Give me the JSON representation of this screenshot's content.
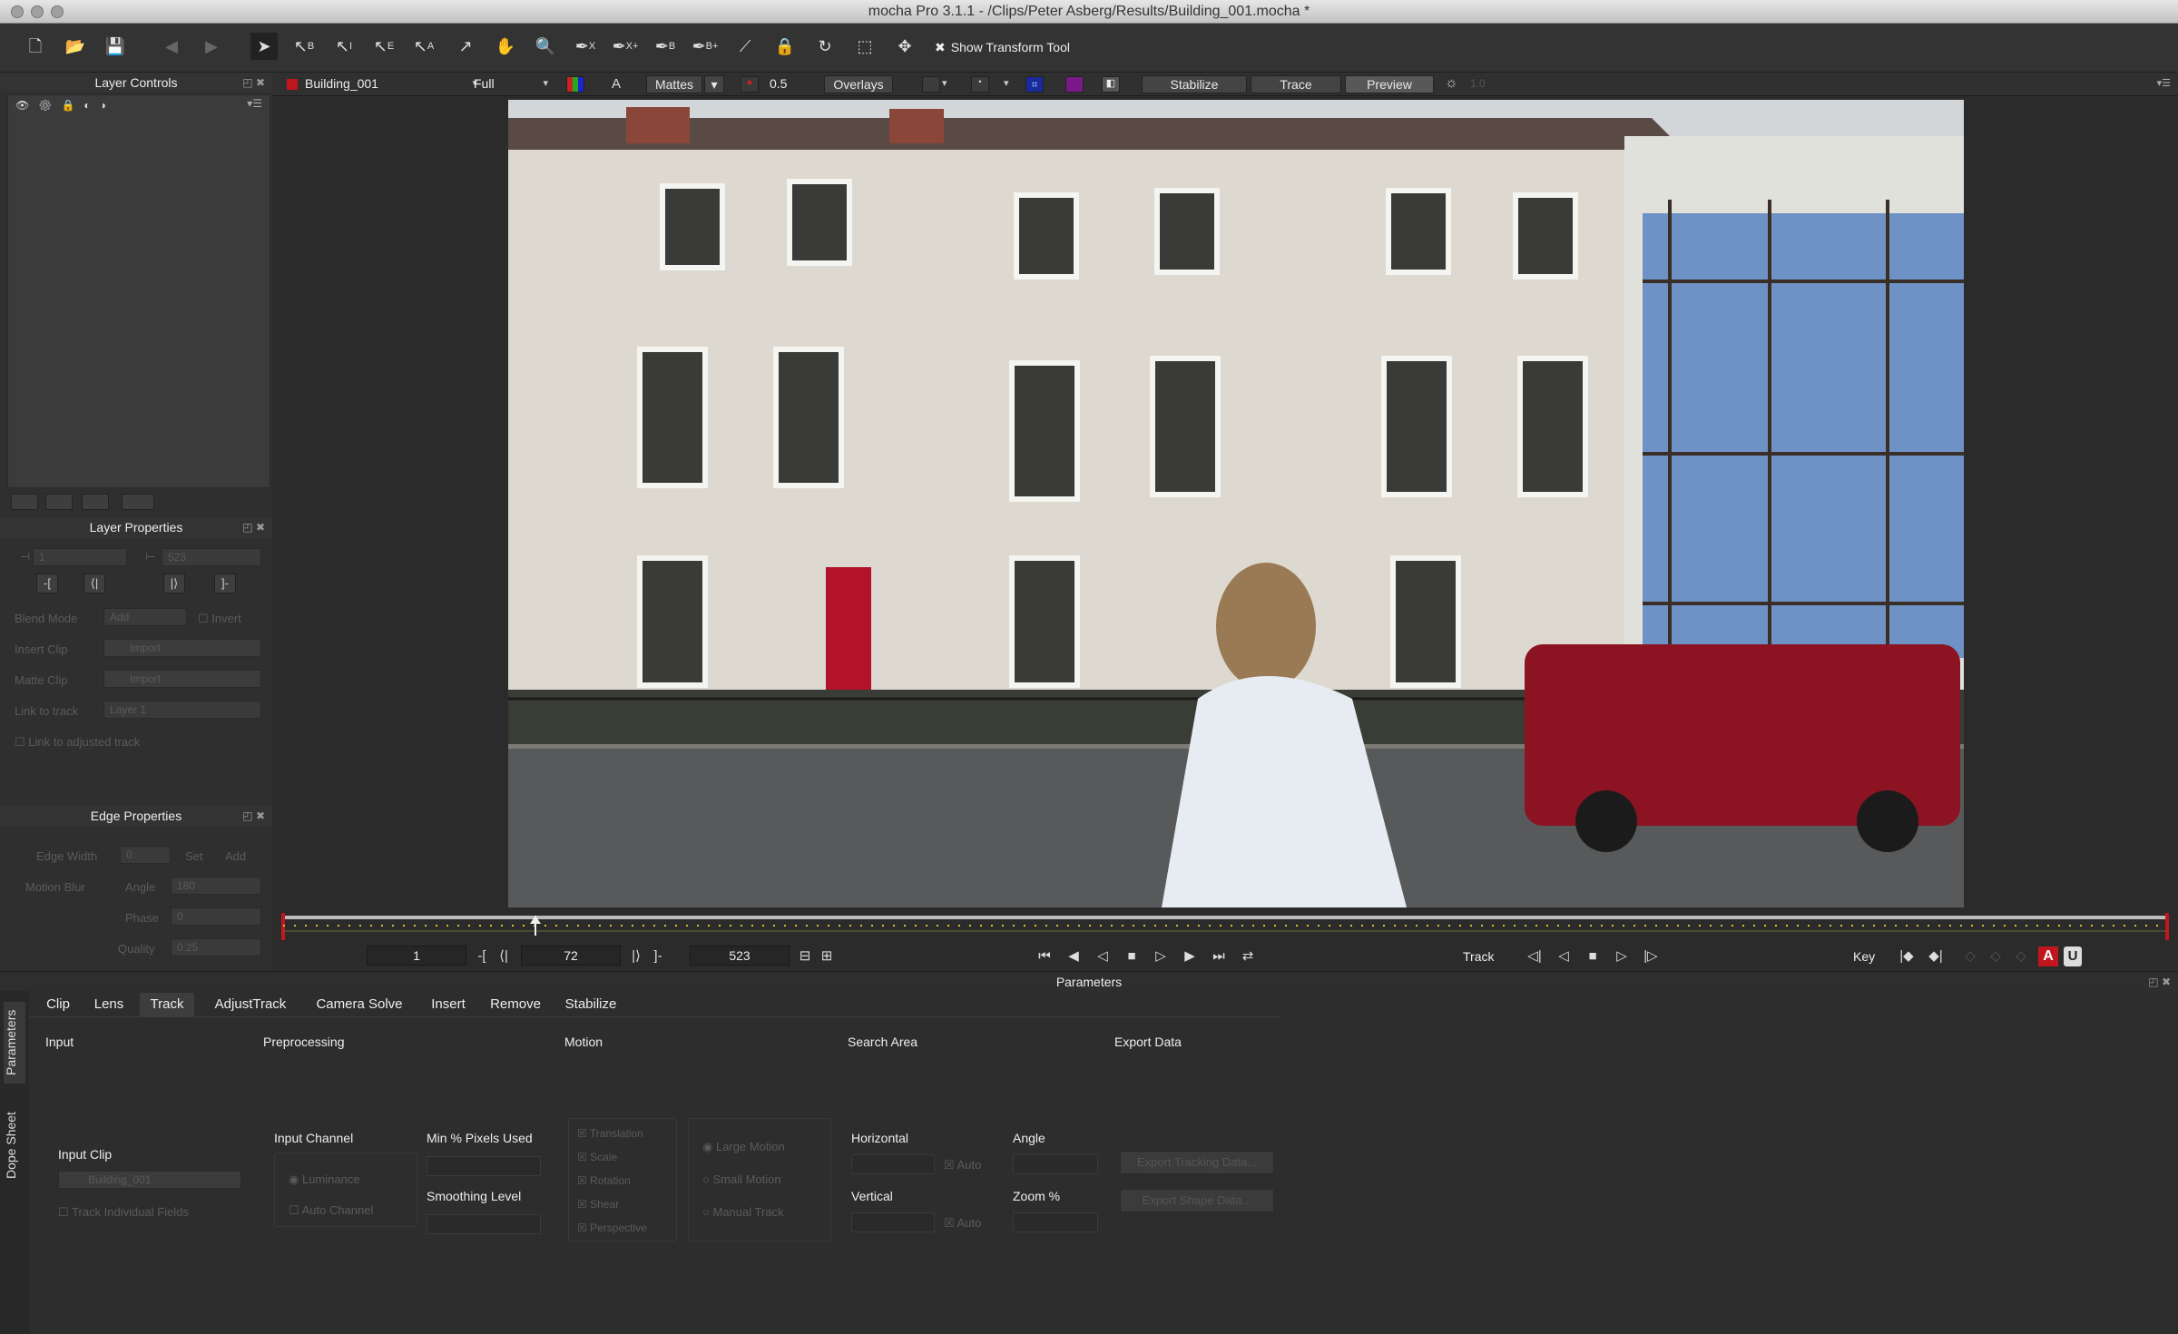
{
  "window": {
    "title": "mocha Pro 3.1.1 - /Clips/Peter Asberg/Results/Building_001.mocha *"
  },
  "toolbar": {
    "show_transform_label": "Show Transform Tool",
    "icons": [
      "new-file-icon",
      "open-folder-icon",
      "save-icon",
      "back-arrow-icon",
      "forward-arrow-icon",
      "pointer-icon",
      "pointer-b-icon",
      "pointer-i-icon",
      "pointer-e-icon",
      "pointer-a-icon",
      "add-point-icon",
      "hand-icon",
      "zoom-icon",
      "pen-x-icon",
      "pen-x-plus-icon",
      "pen-b-icon",
      "pen-b-plus-icon",
      "join-icon",
      "lock-icon",
      "rotate-icon",
      "scale-icon",
      "move-icon"
    ]
  },
  "viewer_bar": {
    "clip": "Building_001",
    "view": "Full",
    "mattes": "Mattes",
    "opacity": "0.5",
    "overlays": "Overlays",
    "stabilize": "Stabilize",
    "trace": "Trace",
    "preview": "Preview",
    "exposure": "1.0"
  },
  "left": {
    "layer_controls": "Layer Controls",
    "layer_properties": "Layer Properties",
    "in_value": "1",
    "out_value": "523",
    "blend_mode_label": "Blend Mode",
    "blend_mode_value": "Add",
    "invert_label": "Invert",
    "insert_clip_label": "Insert Clip",
    "insert_clip_value": "Import",
    "matte_clip_label": "Matte Clip",
    "matte_clip_value": "Import",
    "link_track_label": "Link to track",
    "link_track_value": "Layer 1",
    "link_adjusted_label": "Link to adjusted track",
    "edge_properties": "Edge Properties",
    "edge_width_label": "Edge Width",
    "edge_width_value": "0",
    "set_label": "Set",
    "add_label": "Add",
    "motion_blur_label": "Motion Blur",
    "angle_label": "Angle",
    "angle_value": "180",
    "phase_label": "Phase",
    "phase_value": "0",
    "quality_label": "Quality",
    "quality_value": "0.25"
  },
  "transport": {
    "in_frame": "1",
    "current_frame": "72",
    "out_frame": "523",
    "track_label": "Track",
    "key_label": "Key",
    "auto_key": "A",
    "u_key": "U"
  },
  "parameters": {
    "header": "Parameters",
    "side_tabs": [
      "Parameters",
      "Dope Sheet"
    ],
    "tabs": [
      "Clip",
      "Lens",
      "Track",
      "AdjustTrack",
      "Camera Solve",
      "Insert",
      "Remove",
      "Stabilize"
    ],
    "active_tab": "Track",
    "sections": {
      "input": "Input",
      "preprocessing": "Preprocessing",
      "motion": "Motion",
      "search_area": "Search Area",
      "export_data": "Export Data"
    },
    "input_clip_label": "Input Clip",
    "input_clip_value": "Building_001",
    "track_fields_label": "Track Individual Fields",
    "input_channel_label": "Input Channel",
    "luminance_label": "Luminance",
    "auto_channel_label": "Auto Channel",
    "min_pixels_label": "Min % Pixels Used",
    "smoothing_label": "Smoothing Level",
    "motion_options": [
      "Translation",
      "Scale",
      "Rotation",
      "Shear",
      "Perspective"
    ],
    "motion_types": [
      "Large Motion",
      "Small Motion",
      "Manual Track"
    ],
    "horizontal_label": "Horizontal",
    "vertical_label": "Vertical",
    "auto_label": "Auto",
    "angle_label": "Angle",
    "zoom_label": "Zoom %",
    "export_tracking": "Export Tracking Data...",
    "export_shape": "Export Shape Data..."
  },
  "colors": {
    "accent_red": "#c0171f",
    "timeline_yellow": "#d8c12a"
  }
}
